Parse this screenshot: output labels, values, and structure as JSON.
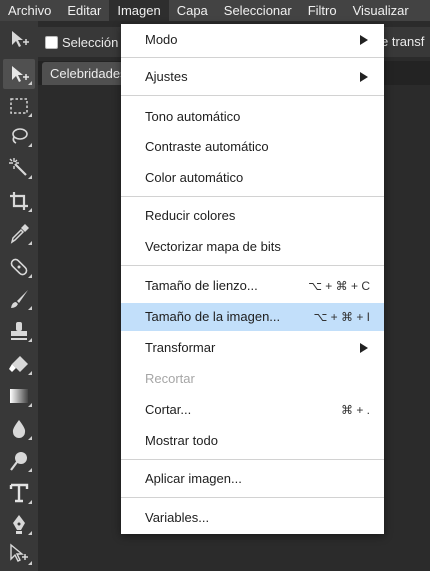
{
  "menubar": {
    "items": [
      "Archivo",
      "Editar",
      "Imagen",
      "Capa",
      "Seleccionar",
      "Filtro",
      "Visualizar"
    ]
  },
  "options": {
    "checkbox_label": "Selección",
    "trailing_text": "e transf"
  },
  "document_tab": {
    "title": "Celebridades"
  },
  "tools": [
    "move-icon",
    "marquee-icon",
    "lasso-icon",
    "magic-wand-icon",
    "crop-icon",
    "eyedropper-icon",
    "healing-icon",
    "brush-icon",
    "stamp-icon",
    "eraser-icon",
    "gradient-icon",
    "blur-icon",
    "dodge-icon",
    "text-icon",
    "pen-icon",
    "path-select-icon"
  ],
  "menu": {
    "modo": "Modo",
    "ajustes": "Ajustes",
    "tono_auto": "Tono automático",
    "contraste_auto": "Contraste automático",
    "color_auto": "Color automático",
    "reducir": "Reducir colores",
    "vectorizar": "Vectorizar mapa de bits",
    "lienzo": "Tamaño de lienzo...",
    "lienzo_sc": "⌥ + ⌘ + C",
    "imagen": "Tamaño de la imagen...",
    "imagen_sc": "⌥ + ⌘ + I",
    "transformar": "Transformar",
    "recortar": "Recortar",
    "cortar": "Cortar...",
    "cortar_sc": "⌘ + .",
    "mostrar": "Mostrar todo",
    "aplicar": "Aplicar imagen...",
    "variables": "Variables..."
  },
  "colors": {
    "highlight": "#c2dffa",
    "menubar": "#434343",
    "toolbar": "#383838"
  }
}
